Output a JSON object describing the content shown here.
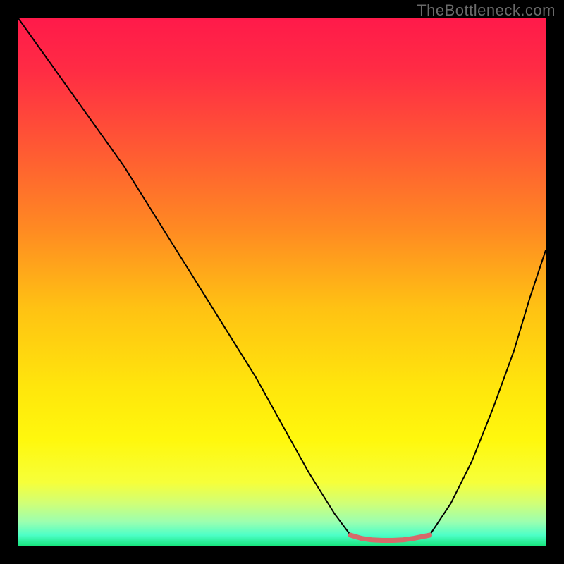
{
  "watermark_text": "TheBottleneck.com",
  "chart_data": {
    "type": "line",
    "title": "",
    "xlabel": "",
    "ylabel": "",
    "xlim": [
      0,
      100
    ],
    "ylim": [
      0,
      100
    ],
    "axes_visible": false,
    "grid": false,
    "background": {
      "type": "vertical_gradient",
      "stops": [
        {
          "pos": 0.0,
          "color": "#ff1a4a"
        },
        {
          "pos": 0.1,
          "color": "#ff2c44"
        },
        {
          "pos": 0.25,
          "color": "#ff5a33"
        },
        {
          "pos": 0.4,
          "color": "#ff8a22"
        },
        {
          "pos": 0.55,
          "color": "#ffc213"
        },
        {
          "pos": 0.7,
          "color": "#ffe60c"
        },
        {
          "pos": 0.8,
          "color": "#fff80d"
        },
        {
          "pos": 0.88,
          "color": "#f6ff3a"
        },
        {
          "pos": 0.92,
          "color": "#d0ff77"
        },
        {
          "pos": 0.955,
          "color": "#9bffb0"
        },
        {
          "pos": 0.98,
          "color": "#4dffc7"
        },
        {
          "pos": 1.0,
          "color": "#18e57f"
        }
      ]
    },
    "series": [
      {
        "name": "left_arm",
        "stroke": "#000000",
        "width": 2,
        "x": [
          0,
          5,
          10,
          15,
          20,
          25,
          30,
          35,
          40,
          45,
          50,
          55,
          60,
          63
        ],
        "y": [
          100,
          93,
          86,
          79,
          72,
          64,
          56,
          48,
          40,
          32,
          23,
          14,
          6,
          2
        ]
      },
      {
        "name": "right_arm",
        "stroke": "#000000",
        "width": 2,
        "x": [
          78,
          82,
          86,
          90,
          94,
          97,
          100
        ],
        "y": [
          2,
          8,
          16,
          26,
          37,
          47,
          56
        ]
      },
      {
        "name": "valley_floor",
        "stroke": "#d66a6a",
        "width": 7,
        "cap": "round",
        "x": [
          63,
          65,
          67,
          69,
          71,
          73,
          75,
          77,
          78
        ],
        "y": [
          2.0,
          1.4,
          1.1,
          1.0,
          1.0,
          1.1,
          1.4,
          1.8,
          2.0
        ]
      }
    ],
    "annotations": []
  }
}
